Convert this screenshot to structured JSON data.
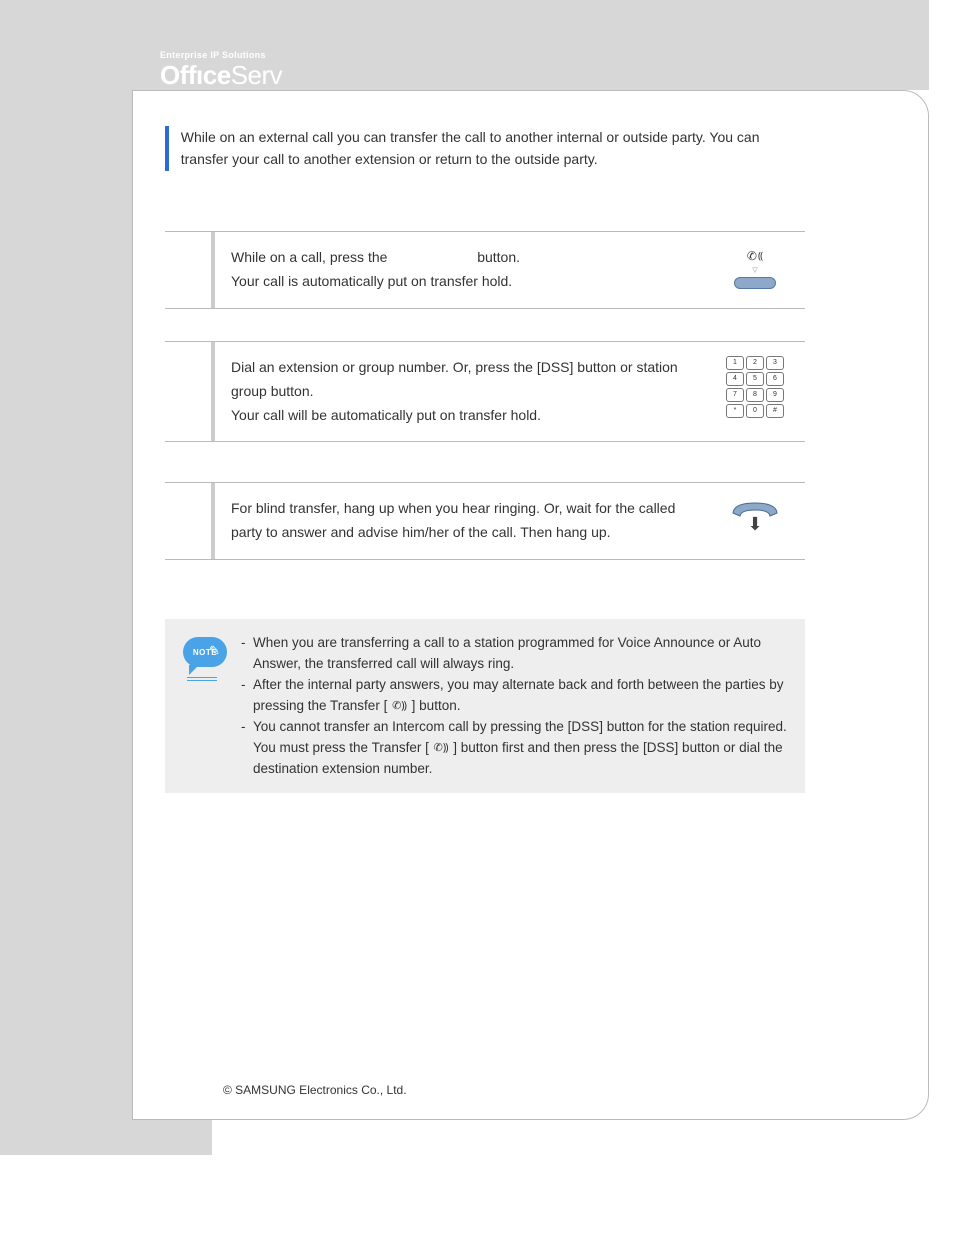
{
  "brand": {
    "tagline": "Enterprise IP Solutions",
    "logo_bold": "Off",
    "logo_i": "ı",
    "logo_bold2": "ce",
    "logo_light": "Serv"
  },
  "intro": "While on an external call you can transfer the call to another internal or outside party. You can transfer your call to another extension or return to the outside party.",
  "step1": {
    "text_a": "While on a call, press the ",
    "text_b": " button.",
    "line2": "Your call is automatically put on transfer hold."
  },
  "step2": {
    "line1": "Dial an extension or group number. Or, press the [DSS] button or station group button.",
    "line2": "Your call will be automatically put on transfer hold."
  },
  "step3": {
    "line1": "For blind transfer, hang up when you hear ringing. Or, wait for the called party to answer and advise him/her of the call. Then hang up."
  },
  "note": {
    "label": "NOTE",
    "item1": "When you are transferring a call to a station programmed for Voice Announce or Auto Answer, the transferred call will always ring.",
    "item2a": "After the internal party answers, you may alternate back and forth between the parties by pressing the Transfer [",
    "item2b": "] button.",
    "item3a": "You cannot transfer an Intercom call by pressing the [DSS] button for the station required. You must press the Transfer [",
    "item3b": "] button first and then press the [DSS] button or dial the destination extension number."
  },
  "keypad": [
    "1",
    "2",
    "3",
    "4",
    "5",
    "6",
    "7",
    "8",
    "9",
    "*",
    "0",
    "#"
  ],
  "footer": "© SAMSUNG Electronics Co., Ltd.",
  "page_number": ""
}
